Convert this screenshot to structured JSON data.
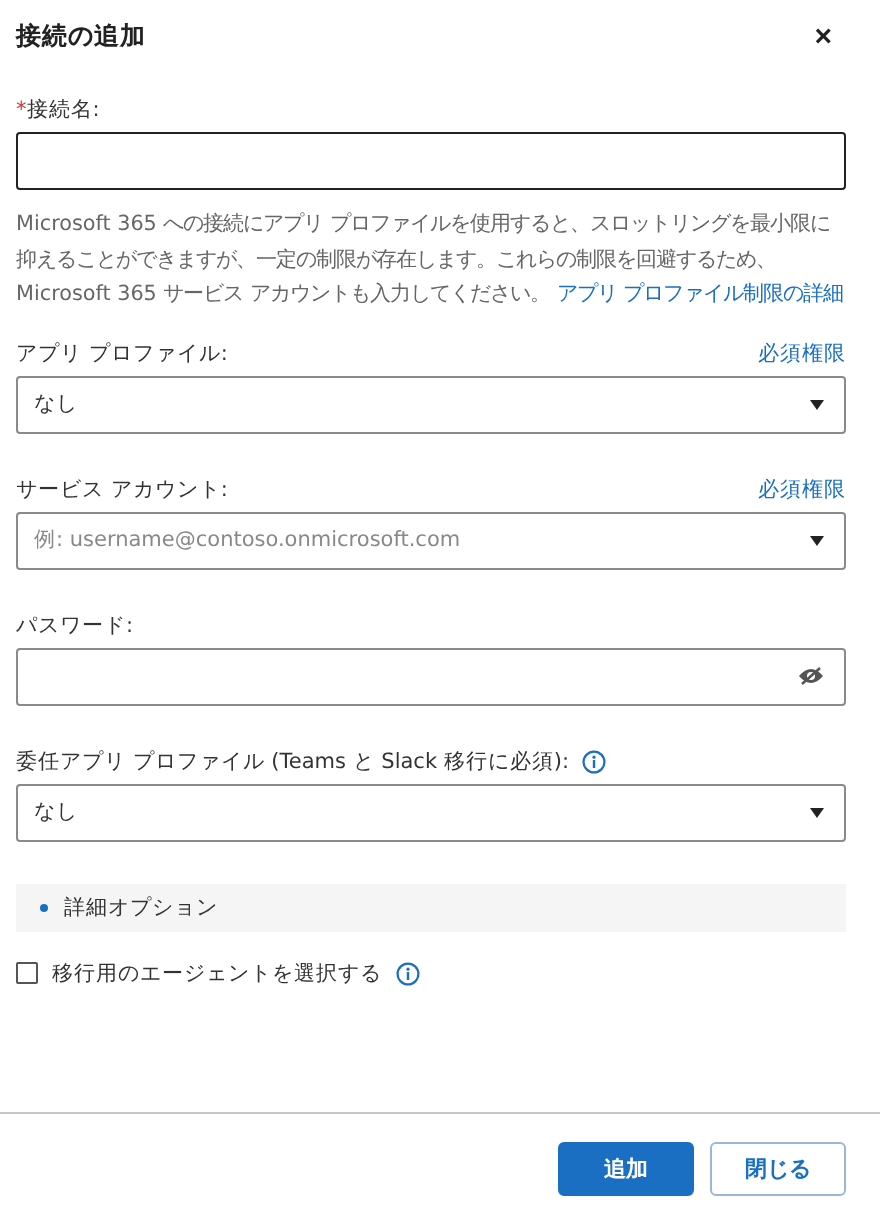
{
  "dialog": {
    "title": "接続の追加",
    "close": "×"
  },
  "form": [
    {
      "kind": "text",
      "label": "接続名:",
      "required_mark": "*"
    },
    {
      "kind": "note",
      "text": "Microsoft 365 への接続にアプリ プロファイルを使用すると、スロットリングを最小限に抑えることができますが、一定の制限が存在します。これらの制限を回避するため、Microsoft 365 サービス アカウントも入力してください。",
      "link": "アプリ プロファイル制限の詳細"
    },
    {
      "kind": "select",
      "label": "アプリ プロファイル:",
      "link": "必須権限",
      "value": "なし"
    },
    {
      "kind": "select",
      "label": "サービス アカウント:",
      "link": "必須権限",
      "placeholder": "例: username@contoso.onmicrosoft.com"
    },
    {
      "kind": "password",
      "label": "パスワード:"
    },
    {
      "kind": "select",
      "label": "委任アプリ プロファイル (Teams と Slack 移行に必須):",
      "info": true,
      "value": "なし"
    },
    {
      "kind": "section",
      "label": "詳細オプション"
    },
    {
      "kind": "checkbox",
      "label": "移行用のエージェントを選択する",
      "checked": false,
      "info": true
    }
  ],
  "buttons": [
    {
      "label": "追加",
      "kind": "primary"
    },
    {
      "label": "閉じる",
      "kind": "secondary"
    }
  ]
}
